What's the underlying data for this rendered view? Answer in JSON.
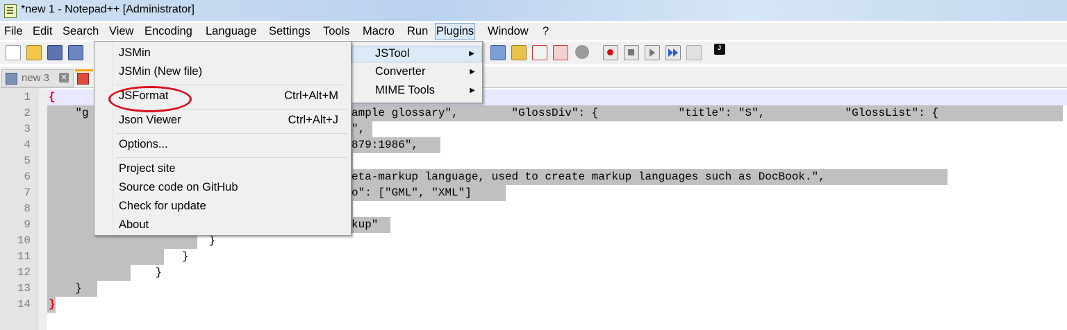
{
  "window": {
    "title": "*new 1 - Notepad++ [Administrator]"
  },
  "menubar": [
    "File",
    "Edit",
    "Search",
    "View",
    "Encoding",
    "Language",
    "Settings",
    "Tools",
    "Macro",
    "Run",
    "Plugins",
    "Window",
    "?"
  ],
  "tabs": [
    {
      "label": "new 3"
    }
  ],
  "editor": {
    "line_numbers": [
      "1",
      "2",
      "3",
      "4",
      "5",
      "6",
      "7",
      "8",
      "9",
      "10",
      "11",
      "12",
      "13",
      "14"
    ],
    "lines": [
      "{",
      "    \"g",
      "",
      "",
      "",
      "",
      "",
      "",
      "",
      "                        }",
      "                    }",
      "                }",
      "    }",
      "}"
    ],
    "visible_fragments": {
      "line2": "ample glossary\",        \"GlossDiv\": {            \"title\": \"S\",            \"GlossList\": {",
      "line3": "\",",
      "line4": "879:1986\",",
      "line6": "eta-markup language, used to create markup languages such as DocBook.\",",
      "line7": "o\": [\"GML\", \"XML\"]",
      "line9": "kup\""
    }
  },
  "jstool_menu": {
    "items": [
      {
        "label": "JSMin",
        "shortcut": ""
      },
      {
        "label": "JSMin (New file)",
        "shortcut": ""
      },
      {
        "label": "JSFormat",
        "shortcut": "Ctrl+Alt+M"
      },
      {
        "label": "Json Viewer",
        "shortcut": "Ctrl+Alt+J"
      },
      {
        "label": "Options...",
        "shortcut": ""
      },
      {
        "label": "Project site",
        "shortcut": ""
      },
      {
        "label": "Source code on GitHub",
        "shortcut": ""
      },
      {
        "label": "Check for update",
        "shortcut": ""
      },
      {
        "label": "About",
        "shortcut": ""
      }
    ]
  },
  "plugins_menu": {
    "items": [
      {
        "label": "JSTool"
      },
      {
        "label": "Converter"
      },
      {
        "label": "MIME Tools"
      }
    ]
  },
  "colors": {
    "selection": "#c0c0c0",
    "highlight": "#d9101e",
    "active_menu": "#dce9f6"
  }
}
